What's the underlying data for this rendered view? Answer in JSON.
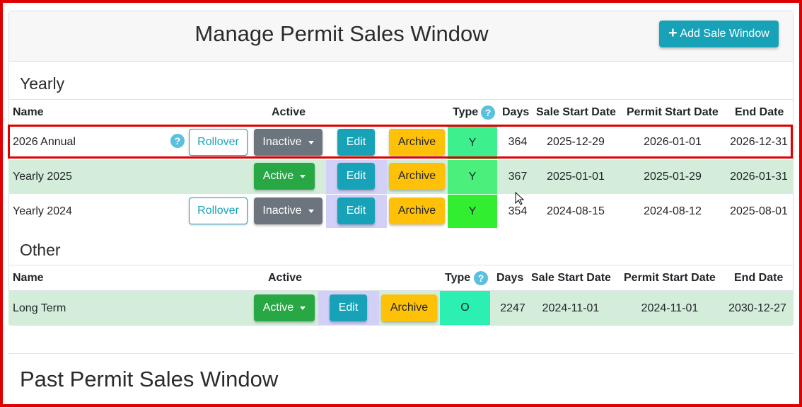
{
  "page": {
    "title": "Manage Permit Sales Window",
    "add_button": {
      "icon": "plus-icon",
      "label": "Add Sale Window"
    },
    "past_title": "Past Permit Sales Window"
  },
  "colors": {
    "info": "#17a2b8",
    "success": "#28a745",
    "secondary": "#6c757d",
    "warning": "#ffc107",
    "row_green": "#d4edda",
    "highlight": "#e00000"
  },
  "yearly": {
    "title": "Yearly",
    "headers": {
      "name": "Name",
      "active": "Active",
      "type": "Type",
      "days": "Days",
      "sale_start": "Sale Start Date",
      "permit_start": "Permit Start Date",
      "end": "End Date"
    },
    "rows": [
      {
        "name": "2026 Annual",
        "help": "?",
        "rollover": "Rollover",
        "status": "Inactive",
        "edit": "Edit",
        "archive": "Archive",
        "type": "Y",
        "type_color": "#3ef08d",
        "days": "364",
        "sale_start": "2025-12-29",
        "permit_start": "2026-01-01",
        "end": "2026-12-31"
      },
      {
        "name": "Yearly 2025",
        "status": "Active",
        "edit": "Edit",
        "archive": "Archive",
        "type": "Y",
        "type_color": "#4af07b",
        "days": "367",
        "sale_start": "2025-01-01",
        "permit_start": "2025-01-29",
        "end": "2026-01-31"
      },
      {
        "name": "Yearly 2024",
        "rollover": "Rollover",
        "status": "Inactive",
        "edit": "Edit",
        "archive": "Archive",
        "type": "Y",
        "type_color": "#31ee31",
        "days": "354",
        "sale_start": "2024-08-15",
        "permit_start": "2024-08-12",
        "end": "2025-08-01"
      }
    ]
  },
  "other": {
    "title": "Other",
    "headers": {
      "name": "Name",
      "active": "Active",
      "type": "Type",
      "days": "Days",
      "sale_start": "Sale Start Date",
      "permit_start": "Permit Start Date",
      "end": "End Date"
    },
    "rows": [
      {
        "name": "Long Term",
        "status": "Active",
        "edit": "Edit",
        "archive": "Archive",
        "type": "O",
        "type_color": "#2bf0b1",
        "days": "2247",
        "sale_start": "2024-11-01",
        "permit_start": "2024-11-01",
        "end": "2030-12-27"
      }
    ]
  }
}
